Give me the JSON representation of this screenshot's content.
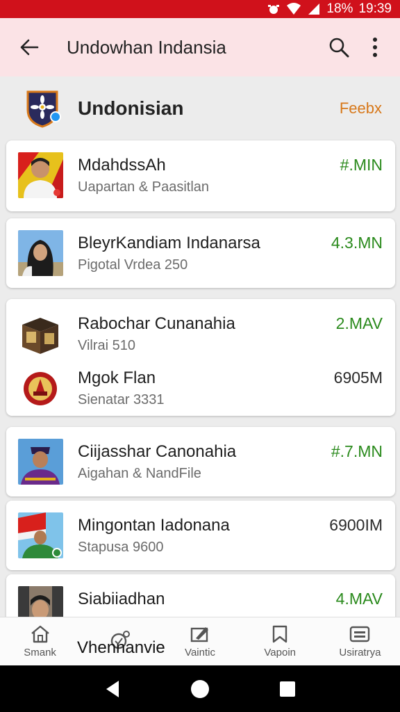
{
  "status_bar": {
    "battery": "18%",
    "time": "19:39"
  },
  "app_bar": {
    "title": "Undowhan Indansia"
  },
  "section": {
    "name": "Undonisian",
    "action": "Feebx"
  },
  "items": [
    {
      "title": "MdahdssAh",
      "subtitle": "Uapartan & Paasitlan",
      "value": "#.MIN"
    },
    {
      "title": "BleyrKandiam Indanarsa",
      "subtitle": "Pigotal Vrdea 250",
      "value": "4.3.MN"
    },
    {
      "title": "Rabochar Cunanahia",
      "subtitle": "Vilrai 510",
      "value": "2.MAV"
    },
    {
      "title": "Mgok Flan",
      "subtitle": "Sienatar 3331",
      "value": "6905M"
    },
    {
      "title": "Ciijasshar Canonahia",
      "subtitle": "Aigahan & NandFile",
      "value": "#.7.MN"
    },
    {
      "title": "Mingontan Iadonana",
      "subtitle": "Stapusa 9600",
      "value": "6900IM"
    },
    {
      "title": "Siabiiadhan",
      "subtitle": "",
      "value": "4.MAV"
    }
  ],
  "overlay_text": "Vhennanvie",
  "bottom_nav": [
    {
      "label": "Smank",
      "icon": "home-icon"
    },
    {
      "label": "",
      "icon": "notification-icon"
    },
    {
      "label": "Vaintic",
      "icon": "edit-icon"
    },
    {
      "label": "Vapoin",
      "icon": "bookmark-icon"
    },
    {
      "label": "Usiratrya",
      "icon": "card-icon"
    }
  ],
  "colors": {
    "status_bar": "#d0111b",
    "app_bar": "#fbe3e6",
    "value_green": "#2a8a1c",
    "feedback_orange": "#d7781a"
  }
}
